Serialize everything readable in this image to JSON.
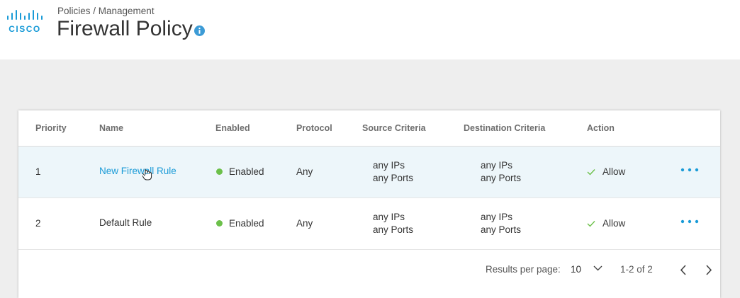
{
  "header": {
    "logo_text": "CISCO",
    "breadcrumb": "Policies / Management",
    "title": "Firewall Policy",
    "info_icon": "info-icon"
  },
  "table": {
    "columns": [
      "Priority",
      "Name",
      "Enabled",
      "Protocol",
      "Source Criteria",
      "Destination Criteria",
      "Action"
    ],
    "rows": [
      {
        "priority": "1",
        "name": "New Firewall Rule",
        "enabled": "Enabled",
        "protocol": "Any",
        "source_ips": "any IPs",
        "source_ports": "any Ports",
        "dest_ips": "any IPs",
        "dest_ports": "any Ports",
        "action": "Allow",
        "highlighted": true
      },
      {
        "priority": "2",
        "name": "Default Rule",
        "enabled": "Enabled",
        "protocol": "Any",
        "source_ips": "any IPs",
        "source_ports": "any Ports",
        "dest_ips": "any IPs",
        "dest_ports": "any Ports",
        "action": "Allow",
        "highlighted": false
      }
    ]
  },
  "pagination": {
    "results_label": "Results per page:",
    "per_page": "10",
    "range": "1-2 of 2"
  },
  "colors": {
    "accent": "#1a9bd7",
    "enabled_dot": "#6cc04a",
    "row_highlight": "#edf6fa"
  }
}
